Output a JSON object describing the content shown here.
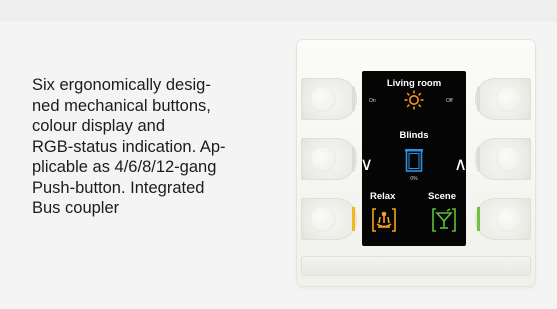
{
  "description": "Six ergonomically desig-\nned mechanical buttons,\ncolour display and\nRGB-status indication. Ap-\nplicable as 4/6/8/12-gang\nPush-button. Integrated\nBus coupler",
  "display": {
    "room_title": "Living room",
    "on_label": "On",
    "off_label": "Off",
    "blinds_title": "Blinds",
    "blinds_percent": "0%",
    "scene1_label": "Relax",
    "scene2_label": "Scene",
    "left_arrow": "∨",
    "right_arrow": "∧"
  },
  "colors": {
    "light_icon": "#f7941d",
    "blinds_icon": "#2f8fe0",
    "relax_icon": "#f7a21b",
    "scene_icon": "#5cbf3a",
    "led_white": "#dcdcdc",
    "led_yellow": "#f2b71f",
    "led_green": "#74c043"
  },
  "icons": [
    "lightbulb-icon",
    "blinds-icon",
    "relax-icon",
    "cocktail-icon"
  ]
}
